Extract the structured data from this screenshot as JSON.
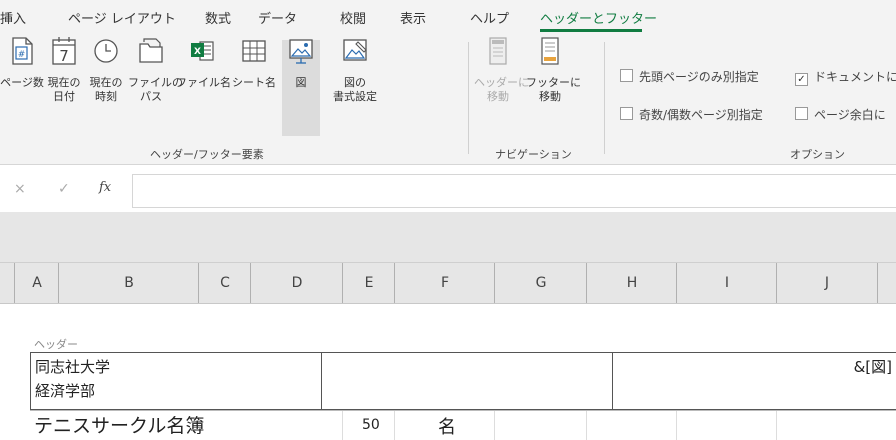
{
  "tabs": [
    {
      "label": "挿入"
    },
    {
      "label": "ページ レイアウト"
    },
    {
      "label": "数式"
    },
    {
      "label": "データ"
    },
    {
      "label": "校閲"
    },
    {
      "label": "表示"
    },
    {
      "label": "ヘルプ"
    },
    {
      "label": "ヘッダーとフッター"
    }
  ],
  "active_tab_index": 7,
  "ribbon": {
    "elements_group": {
      "label": "ヘッダー/フッター要素",
      "buttons": [
        {
          "label": "ページ数",
          "icon": "page-number-icon"
        },
        {
          "label": "現在の\n日付",
          "icon": "calendar-icon"
        },
        {
          "label": "現在の\n時刻",
          "icon": "clock-icon"
        },
        {
          "label": "ファイルの\nパス",
          "icon": "folder-icon"
        },
        {
          "label": "ファイル名",
          "icon": "excel-file-icon"
        },
        {
          "label": "シート名",
          "icon": "sheet-grid-icon"
        },
        {
          "label": "図",
          "icon": "picture-icon"
        },
        {
          "label": "図の\n書式設定",
          "icon": "format-picture-icon"
        }
      ]
    },
    "nav_group": {
      "label": "ナビゲーション",
      "buttons": [
        {
          "label": "ヘッダーに\n移動",
          "icon": "go-to-header-icon",
          "disabled": true
        },
        {
          "label": "フッターに\n移動",
          "icon": "go-to-footer-icon",
          "disabled": false
        }
      ]
    },
    "options_group": {
      "label": "オプション",
      "options": [
        {
          "label": "先頭ページのみ別指定",
          "checked": false
        },
        {
          "label": "ドキュメントに合",
          "checked": true
        },
        {
          "label": "奇数/偶数ページ別指定",
          "checked": false
        },
        {
          "label": "ページ余白に",
          "checked": false
        }
      ]
    }
  },
  "formula_bar": {
    "cancel": "×",
    "enter": "✓",
    "fx": "fx",
    "value": ""
  },
  "columns": [
    "A",
    "B",
    "C",
    "D",
    "E",
    "F",
    "G",
    "H",
    "I",
    "J"
  ],
  "header_section": {
    "label": "ヘッダー",
    "left_text_line1": "同志社大学",
    "left_text_line2": "経済学部",
    "right_text": "&[図]"
  },
  "sheet_row": {
    "title": "テニスサークル名簿",
    "count": "50",
    "unit": "名"
  },
  "colors": {
    "accent": "#107c41",
    "ribbon_bg": "#f3f3f3",
    "canvas_bg": "#e6e6e6"
  }
}
